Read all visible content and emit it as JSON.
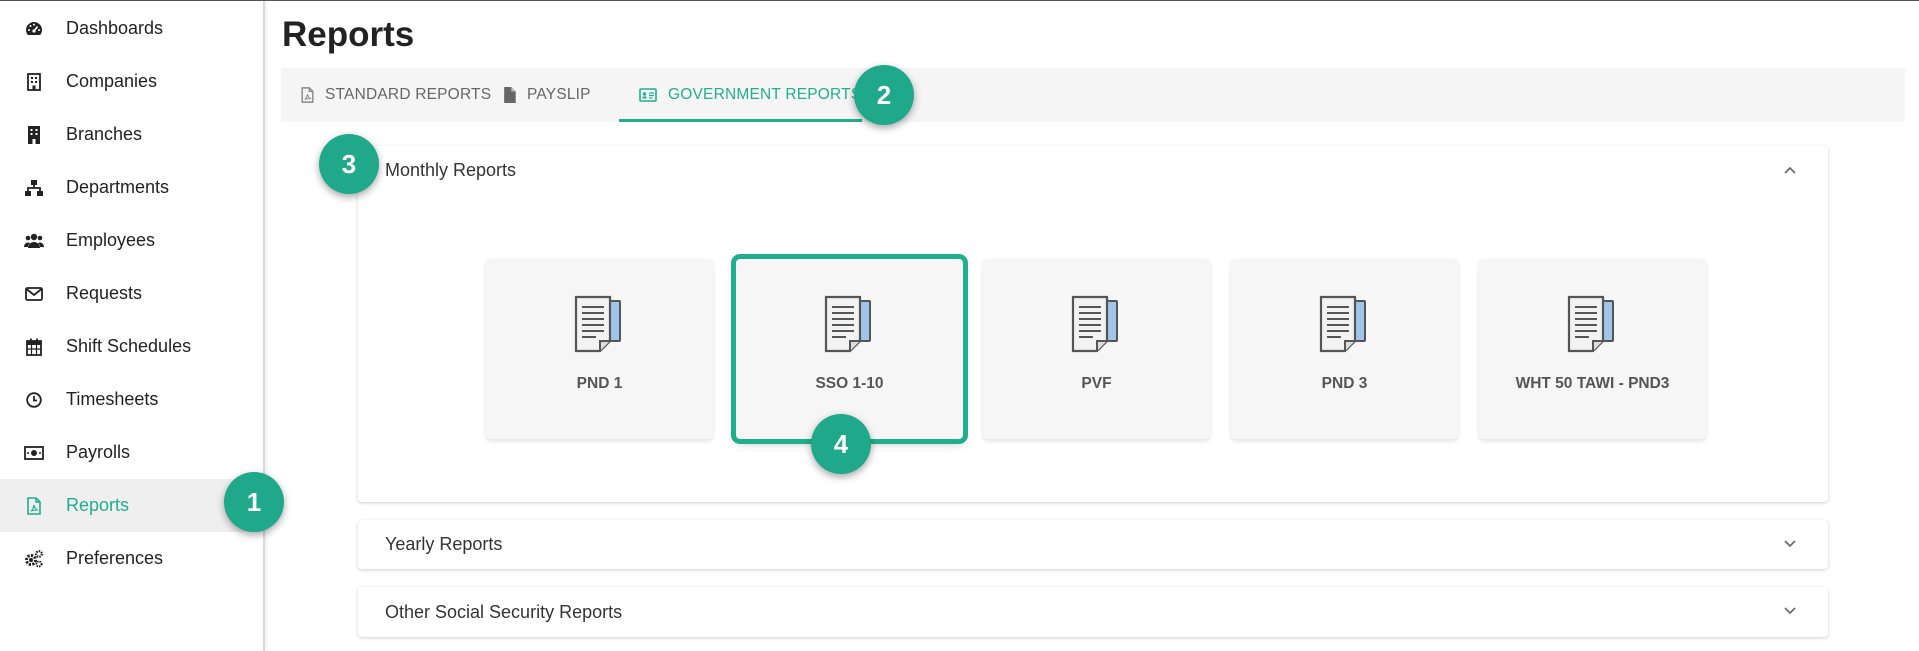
{
  "sidebar": {
    "items": [
      {
        "label": "Dashboards",
        "icon": "dashboard-gauge-icon",
        "active": false
      },
      {
        "label": "Companies",
        "icon": "building-icon",
        "active": false
      },
      {
        "label": "Branches",
        "icon": "office-building-icon",
        "active": false
      },
      {
        "label": "Departments",
        "icon": "org-chart-icon",
        "active": false
      },
      {
        "label": "Employees",
        "icon": "users-icon",
        "active": false
      },
      {
        "label": "Requests",
        "icon": "envelope-icon",
        "active": false
      },
      {
        "label": "Shift Schedules",
        "icon": "calendar-icon",
        "active": false
      },
      {
        "label": "Timesheets",
        "icon": "clock-icon",
        "active": false
      },
      {
        "label": "Payrolls",
        "icon": "money-bill-icon",
        "active": false
      },
      {
        "label": "Reports",
        "icon": "pdf-file-icon",
        "active": true
      },
      {
        "label": "Preferences",
        "icon": "gears-icon",
        "active": false
      }
    ]
  },
  "page": {
    "title": "Reports"
  },
  "tabs": [
    {
      "label": "STANDARD REPORTS",
      "icon": "pdf-file-icon",
      "active": false
    },
    {
      "label": "PAYSLIP",
      "icon": "file-icon",
      "active": false
    },
    {
      "label": "GOVERNMENT REPORTS",
      "icon": "id-card-icon",
      "active": true
    }
  ],
  "sections": {
    "monthly": {
      "title": "Monthly Reports",
      "expanded": true,
      "cards": [
        {
          "label": "PND 1",
          "icon": "document-icon"
        },
        {
          "label": "SSO 1-10",
          "icon": "document-icon",
          "highlighted": true
        },
        {
          "label": "PVF",
          "icon": "document-icon"
        },
        {
          "label": "PND 3",
          "icon": "document-icon"
        },
        {
          "label": "WHT 50 TAWI - PND3",
          "icon": "document-icon"
        }
      ]
    },
    "yearly": {
      "title": "Yearly Reports",
      "expanded": false
    },
    "other": {
      "title": "Other Social Security Reports",
      "expanded": false
    }
  },
  "step_badges": [
    "1",
    "2",
    "3",
    "4"
  ],
  "colors": {
    "accent": "#1fae8e",
    "badge": "#1fa88a",
    "tab_bar_bg": "#f5f5f5",
    "card_bg": "#f6f6f6"
  }
}
